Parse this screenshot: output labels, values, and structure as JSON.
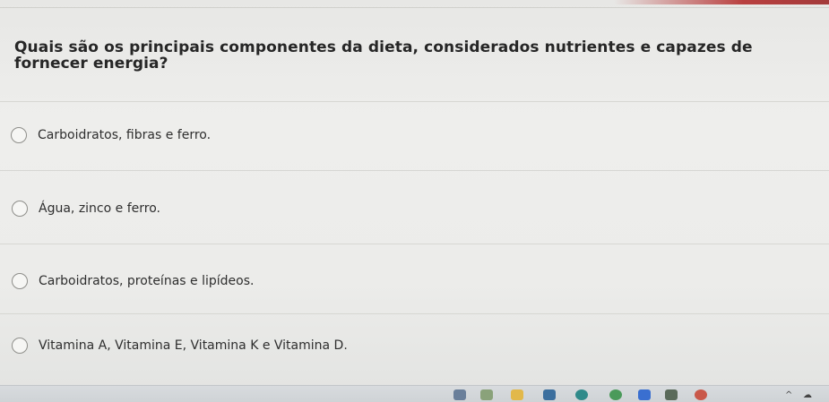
{
  "question": {
    "text": "Quais são os principais componentes da dieta, considerados nutrientes e capazes de fornecer energia?"
  },
  "options": [
    {
      "label": "Carboidratos, fibras e ferro."
    },
    {
      "label": "Água, zinco e ferro."
    },
    {
      "label": "Carboidratos, proteínas e lipídeos."
    },
    {
      "label": "Vitamina A, Vitamina E, Vitamina K e Vitamina D."
    }
  ],
  "taskbar": {
    "icons": [
      "app-icon",
      "app-icon",
      "folder-icon",
      "store-icon",
      "edge-icon",
      "chrome-icon",
      "dropbox-icon",
      "app-icon",
      "media-icon"
    ],
    "tray": [
      "chevron-up-icon",
      "onedrive-icon"
    ]
  },
  "colors": {
    "background": "#ececea",
    "text": "#262626",
    "radio_border": "#8e8e8a",
    "accent_strip": "#b94040"
  }
}
